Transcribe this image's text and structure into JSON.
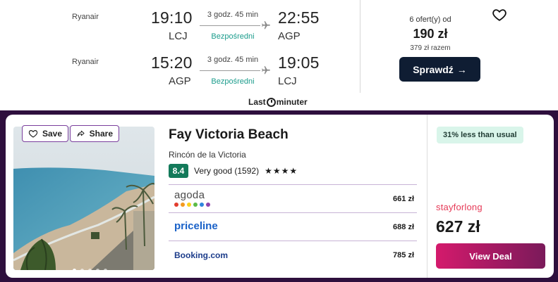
{
  "flight": {
    "legs": [
      {
        "airline": "Ryanair",
        "dep_time": "19:10",
        "dep_code": "LCJ",
        "duration": "3 godz. 45 min",
        "stops": "Bezpośredni",
        "arr_time": "22:55",
        "arr_code": "AGP"
      },
      {
        "airline": "Ryanair",
        "dep_time": "15:20",
        "dep_code": "AGP",
        "duration": "3 godz. 45 min",
        "stops": "Bezpośredni",
        "arr_time": "19:05",
        "arr_code": "LCJ"
      }
    ],
    "offers_label": "6 ofert(y) od",
    "price": "190 zł",
    "total_label": "379 zł razem",
    "check_button": "Sprawdź",
    "check_arrow": "→",
    "favorite_icon": "heart-outline-icon",
    "provider_logo": {
      "before": "Last",
      "after": "minuter"
    }
  },
  "hotel": {
    "save_label": "Save",
    "share_label": "Share",
    "name": "Fay Victoria Beach",
    "location": "Rincón de la Victoria",
    "rating_score": "8.4",
    "rating_text": "Very good (1592)",
    "stars": "★★★★",
    "photo_dots": 5,
    "providers": [
      {
        "name": "agoda",
        "price": "661 zł"
      },
      {
        "name": "priceline",
        "price": "688 zł"
      },
      {
        "name": "Booking.com",
        "price": "785 zł"
      }
    ],
    "agoda_dot_colors": [
      "#e23d2e",
      "#f39a1f",
      "#fbd01b",
      "#5dbb46",
      "#2e86de",
      "#8e44ad"
    ],
    "deal_badge": "31% less than usual",
    "best_provider": "stayforlong",
    "best_price": "627 zł",
    "view_deal_label": "View Deal"
  },
  "colors": {
    "dark_navy": "#0f1d33",
    "teal": "#1b9c8c",
    "band_purple": "#2e0f3d",
    "rating_green": "#137a5a",
    "deal_bg": "#d9f5ea",
    "cta_start": "#d41a6c",
    "cta_end": "#7a1a5a"
  }
}
